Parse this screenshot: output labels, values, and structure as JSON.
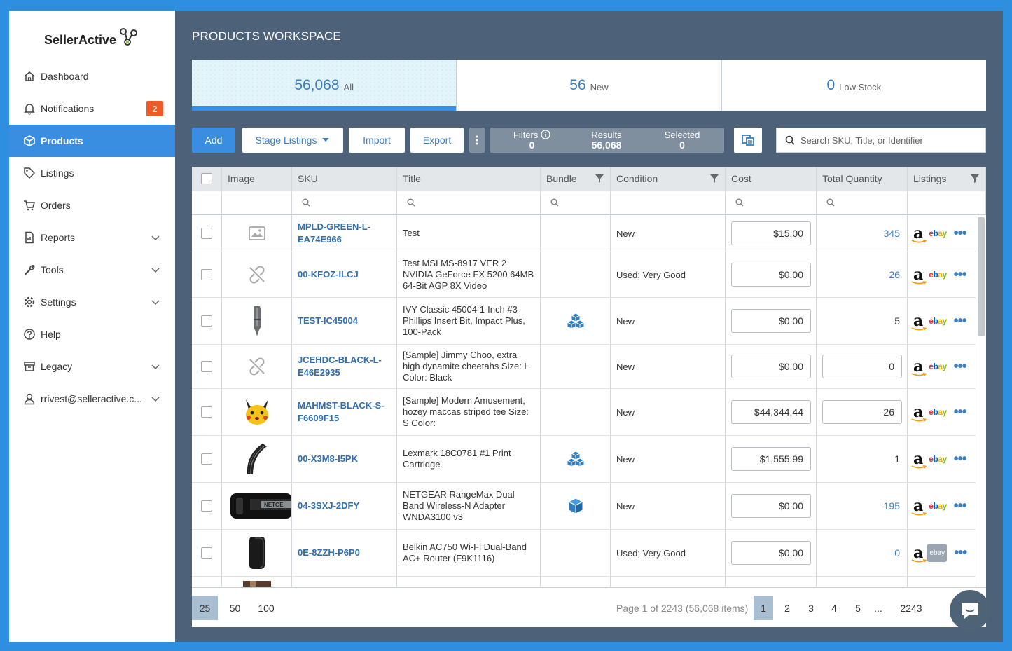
{
  "app": {
    "brand": "SellerActive"
  },
  "sidebar": {
    "items": [
      {
        "label": "Dashboard",
        "icon": "home-icon"
      },
      {
        "label": "Notifications",
        "icon": "bell-icon",
        "badge": "2"
      },
      {
        "label": "Products",
        "icon": "box-icon",
        "active": true
      },
      {
        "label": "Listings",
        "icon": "tag-icon"
      },
      {
        "label": "Orders",
        "icon": "cart-icon"
      },
      {
        "label": "Reports",
        "icon": "report-icon",
        "expandable": true
      },
      {
        "label": "Tools",
        "icon": "wrench-icon",
        "expandable": true
      },
      {
        "label": "Settings",
        "icon": "gear-icon",
        "expandable": true
      },
      {
        "label": "Help",
        "icon": "help-icon"
      },
      {
        "label": "Legacy",
        "icon": "archive-icon",
        "expandable": true
      },
      {
        "label": "rrivest@selleractive.c...",
        "icon": "user-icon",
        "expandable": true
      }
    ]
  },
  "main": {
    "title": "PRODUCTS WORKSPACE",
    "tabs": [
      {
        "count": "56,068",
        "label": "All"
      },
      {
        "count": "56",
        "label": "New"
      },
      {
        "count": "0",
        "label": "Low Stock"
      }
    ],
    "toolbar": {
      "add": "Add",
      "stage": "Stage Listings",
      "import": "Import",
      "export": "Export",
      "filters_label": "Filters",
      "filters_value": "0",
      "results_label": "Results",
      "results_value": "56,068",
      "selected_label": "Selected",
      "selected_value": "0",
      "search_placeholder": "Search SKU, Title, or Identifier"
    },
    "columns": [
      "Image",
      "SKU",
      "Title",
      "Bundle",
      "Condition",
      "Cost",
      "Total Quantity",
      "Listings"
    ],
    "rows": [
      {
        "sku": "MPLD-GREEN-L-EA74E966",
        "title": "Test",
        "condition": "New",
        "cost": "$15.00",
        "qty": "345",
        "qty_type": "link",
        "image": "placeholder",
        "bundle": ""
      },
      {
        "sku": "00-KFOZ-ILCJ",
        "title": "Test MSI MS-8917 VER 2 NVIDIA GeForce FX 5200 64MB 64-Bit AGP 8X Video",
        "condition": "Used; Very Good",
        "cost": "$0.00",
        "qty": "26",
        "qty_type": "link",
        "image": "broken",
        "bundle": ""
      },
      {
        "sku": "TEST-IC45004",
        "title": "IVY Classic 45004 1-Inch #3 Phillips Insert Bit, Impact Plus, 100-Pack",
        "condition": "New",
        "cost": "$0.00",
        "qty": "5",
        "qty_type": "plain",
        "image": "bit",
        "bundle": "multi"
      },
      {
        "sku": "JCEHDC-BLACK-L-E46E2935",
        "title": "[Sample] Jimmy Choo, extra high dynamite cheetahs Size: L Color: Black",
        "condition": "New",
        "cost": "$0.00",
        "qty": "0",
        "qty_type": "input",
        "image": "broken",
        "bundle": ""
      },
      {
        "sku": "MAHMST-BLACK-S-F6609F15",
        "title": "[Sample] Modern Amusement, hozey maccas striped tee Size: S Color:",
        "condition": "New",
        "cost": "$44,344.44",
        "qty": "26",
        "qty_type": "input",
        "image": "pikachu",
        "bundle": ""
      },
      {
        "sku": "00-X3M8-I5PK",
        "title": "Lexmark 18C0781 #1 Print Cartridge",
        "condition": "New",
        "cost": "$1,555.99",
        "qty": "1",
        "qty_type": "plain",
        "image": "tire",
        "bundle": "multi"
      },
      {
        "sku": "04-3SXJ-2DFY",
        "title": "NETGEAR RangeMax Dual Band Wireless-N Adapter WNDA3100 v3",
        "condition": "New",
        "cost": "$0.00",
        "qty": "195",
        "qty_type": "link",
        "image": "netgear",
        "bundle": "single"
      },
      {
        "sku": "0E-8ZZH-P6P0",
        "title": "Belkin AC750 Wi-Fi Dual-Band AC+ Router (F9K1116)",
        "condition": "Used; Very Good",
        "cost": "$0.00",
        "qty": "0",
        "qty_type": "link",
        "image": "router",
        "bundle": "",
        "ebay_inactive": true
      },
      {
        "sku": "",
        "title": "",
        "condition": "",
        "cost": "",
        "qty": "",
        "qty_type": "plain",
        "image": "partial",
        "bundle": ""
      }
    ],
    "listing_labels": {
      "amazon": "a",
      "ebay": "ebay"
    },
    "footer": {
      "page_sizes": [
        "25",
        "50",
        "100"
      ],
      "page_info": "Page 1 of 2243 (56,068 items)",
      "pages": [
        "1",
        "2",
        "3",
        "4",
        "5",
        "...",
        "2243"
      ]
    }
  }
}
